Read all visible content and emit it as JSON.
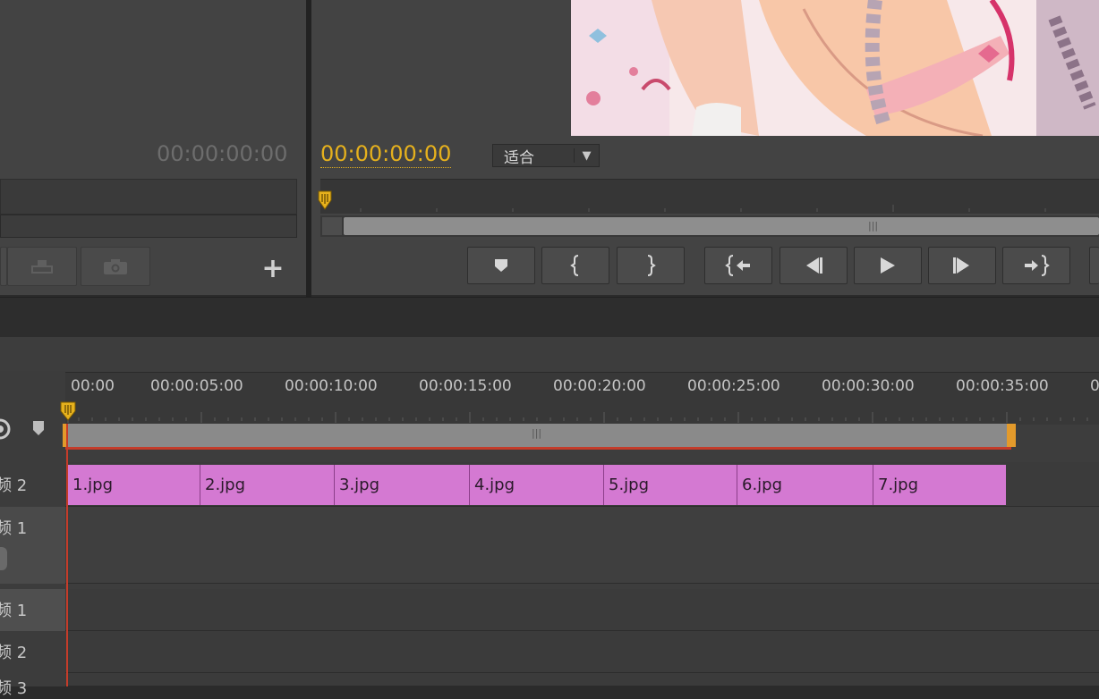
{
  "source_monitor": {
    "timecode": "00:00:00:00",
    "add_button_label": "+"
  },
  "program_monitor": {
    "timecode": "00:00:00:00",
    "zoom_value": "适合",
    "buttons": [
      {
        "name": "add-marker-button",
        "icon": "marker-icon"
      },
      {
        "name": "mark-in-button",
        "icon": "mark-in-icon"
      },
      {
        "name": "mark-out-button",
        "icon": "mark-out-icon"
      },
      {
        "name": "go-to-in-button",
        "icon": "go-to-in-icon"
      },
      {
        "name": "step-back-button",
        "icon": "step-back-icon"
      },
      {
        "name": "play-button",
        "icon": "play-icon"
      },
      {
        "name": "step-forward-button",
        "icon": "step-forward-icon"
      },
      {
        "name": "go-to-out-button",
        "icon": "go-to-out-icon"
      }
    ]
  },
  "timeline": {
    "ruler_labels": [
      "00:00",
      "00:00:05:00",
      "00:00:10:00",
      "00:00:15:00",
      "00:00:20:00",
      "00:00:25:00",
      "00:00:30:00",
      "00:00:35:00",
      "0"
    ],
    "tracks": [
      {
        "label": "频 2"
      },
      {
        "label": "频 1"
      },
      {
        "label": "频 1"
      },
      {
        "label": "频 2"
      },
      {
        "label": "频 3"
      }
    ],
    "clips": [
      "1.jpg",
      "2.jpg",
      "3.jpg",
      "4.jpg",
      "5.jpg",
      "6.jpg",
      "7.jpg"
    ]
  },
  "colors": {
    "accent_timecode": "#e6b11d",
    "clip_fill": "#d479d2",
    "playhead_red": "#c43c2a",
    "workarea_end": "#e39a2b"
  }
}
